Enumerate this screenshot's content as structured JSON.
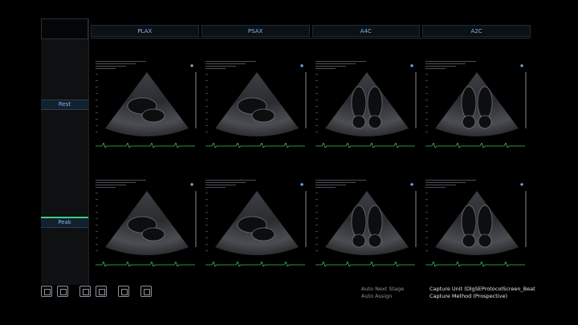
{
  "views": [
    "PLAX",
    "PSAX",
    "A4C",
    "A2C"
  ],
  "stages": [
    "Rest",
    "Peak"
  ],
  "active_stage": "Peak",
  "status": {
    "auto_next_stage": "Auto Next Stage",
    "auto_assign": "Auto Assign",
    "capture_unit": "Capture Unit (DlgSEProtocolScreen_Beat",
    "capture_method": "Capture Method (Prospective)"
  },
  "toolbar": {
    "icons": [
      "select-icon",
      "assign-icon",
      "layout-grid-icon",
      "expand-icon",
      "review-icon",
      "protocol-icon"
    ]
  },
  "colors": {
    "accent": "#7fb4e4",
    "active": "#39d27a",
    "ecg": "#3bbf5a"
  }
}
